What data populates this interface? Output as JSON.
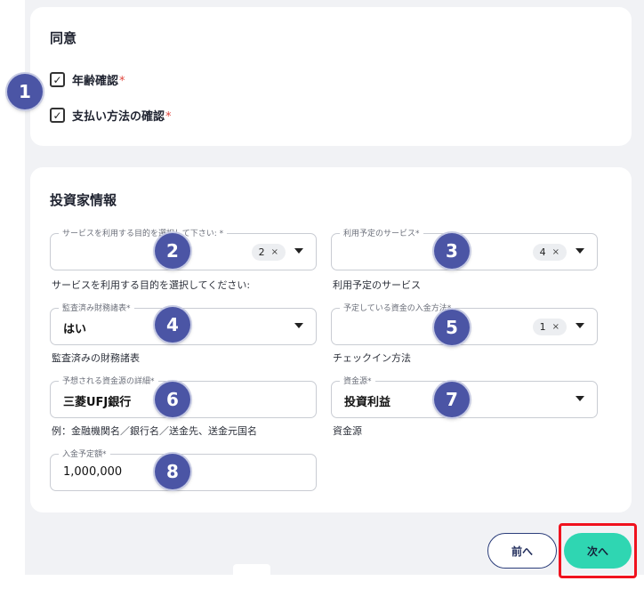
{
  "consent": {
    "title": "同意",
    "items": [
      {
        "label": "年齢確認",
        "required_mark": "*",
        "checked": true,
        "check_glyph": "✓"
      },
      {
        "label": "支払い方法の確認",
        "required_mark": "*",
        "checked": true,
        "check_glyph": "✓"
      }
    ]
  },
  "investor": {
    "title": "投資家情報",
    "fields": {
      "purpose": {
        "label": "サービスを利用する目的を選択して下さい: *",
        "chip": "2",
        "chip_x": "×",
        "helper": "サービスを利用する目的を選択してください:"
      },
      "services": {
        "label": "利用予定のサービス*",
        "chip": "4",
        "chip_x": "×",
        "helper": "利用予定のサービス"
      },
      "audited": {
        "label": "監査済み財務諸表*",
        "value": "はい",
        "helper": "監査済みの財務諸表"
      },
      "deposit_method": {
        "label": "予定している資金の入金方法*",
        "chip": "1",
        "chip_x": "×",
        "helper": "チェックイン方法"
      },
      "fund_detail": {
        "label": "予想される資金源の詳細*",
        "value": "三菱UFJ銀行",
        "helper": "例：金融機関名／銀行名／送金先、送金元国名"
      },
      "fund_source": {
        "label": "資金源*",
        "value": "投資利益",
        "helper": "資金源"
      },
      "amount": {
        "label": "入金予定額*",
        "value": "1,000,000"
      }
    }
  },
  "markers": [
    "1",
    "2",
    "3",
    "4",
    "5",
    "6",
    "7",
    "8"
  ],
  "buttons": {
    "prev": "前へ",
    "next": "次へ"
  },
  "colors": {
    "accent": "#2fd6b2",
    "marker": "#4b55a5",
    "highlight": "#f0121e",
    "required": "#e0443c"
  }
}
